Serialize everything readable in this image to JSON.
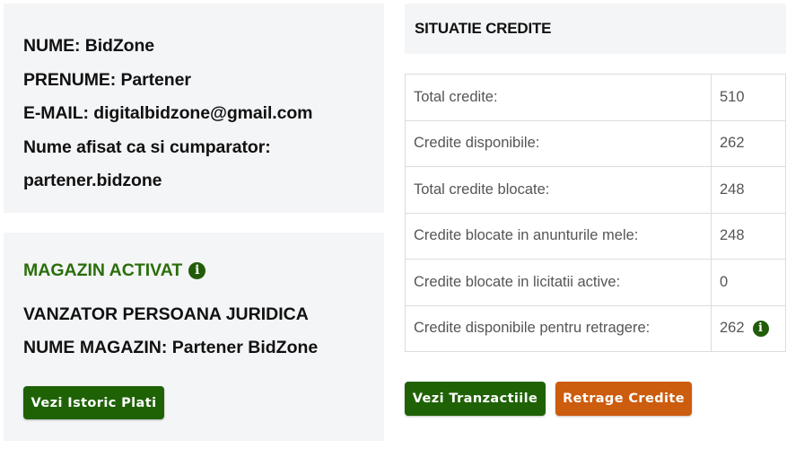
{
  "profile": {
    "lines": [
      "NUME: BidZone",
      "PRENUME: Partener",
      "E-MAIL: digitalbidzone@gmail.com",
      "Nume afisat ca si cumparator:",
      "partener.bidzone"
    ]
  },
  "shop": {
    "status": "MAGAZIN ACTIVAT",
    "status_color": "#2a6e0b",
    "status_icon": "info-circle-icon",
    "seller_type": "VANZATOR PERSOANA JURIDICA",
    "shop_name": "NUME MAGAZIN: Partener BidZone",
    "history_button": "Vezi Istoric Plati"
  },
  "credits": {
    "title": "SITUATIE CREDITE",
    "rows": [
      {
        "label": "Total credite:",
        "value": "510"
      },
      {
        "label": "Credite disponibile:",
        "value": "262"
      },
      {
        "label": "Total credite blocate:",
        "value": "248"
      },
      {
        "label": "Credite blocate in anunturile mele:",
        "value": "248"
      },
      {
        "label": "Credite blocate in licitatii active:",
        "value": "0"
      },
      {
        "label": "Credite disponibile pentru retragere:",
        "value": "262",
        "icon": "info-circle-icon"
      }
    ],
    "transactions_button": "Vezi Tranzactiile",
    "withdraw_button": "Retrage Credite"
  },
  "colors": {
    "green_button": "#1f6206",
    "orange_button": "#cc5c0e",
    "panel_background": "#f4f5f7"
  },
  "info_glyph": "i"
}
